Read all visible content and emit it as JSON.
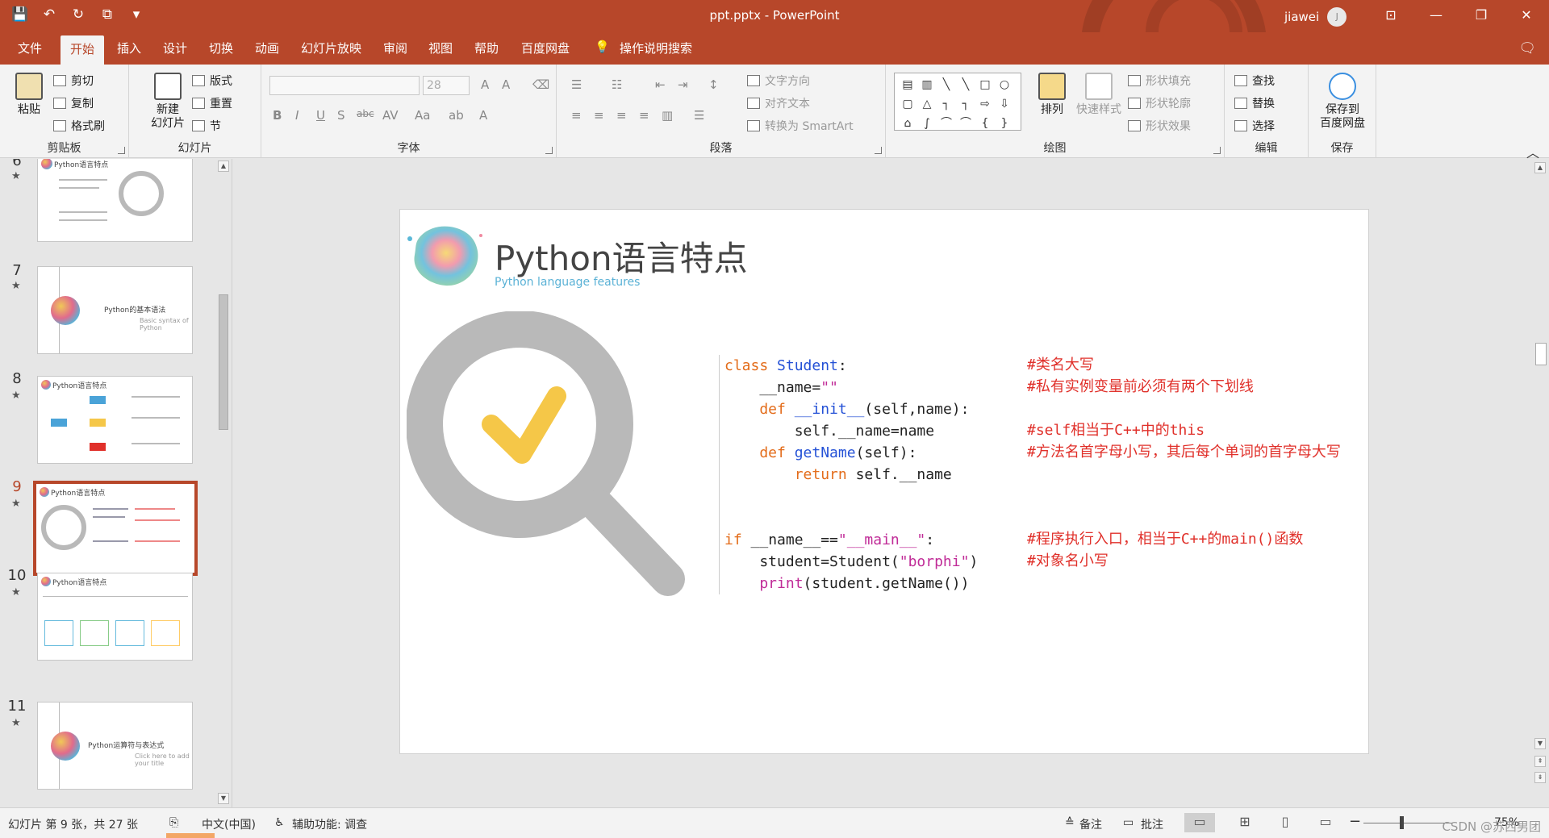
{
  "window": {
    "title": "ppt.pptx  -  PowerPoint",
    "user": "jiawei",
    "avatar_letter": "J"
  },
  "qat": {
    "save": "💾",
    "undo": "↶",
    "redo": "↻",
    "present": "⧉",
    "more": "▾"
  },
  "window_buttons": {
    "ribbon_display": "⊡",
    "minimize": "—",
    "restore": "❐",
    "close": "✕"
  },
  "menu": {
    "tabs": [
      "文件",
      "开始",
      "插入",
      "设计",
      "切换",
      "动画",
      "幻灯片放映",
      "审阅",
      "视图",
      "帮助",
      "百度网盘"
    ],
    "active_tab": "开始",
    "tell_me": "操作说明搜索"
  },
  "ribbon": {
    "clipboard": {
      "paste": "粘贴",
      "cut": "剪切",
      "copy": "复制",
      "format_painter": "格式刷",
      "label": "剪贴板"
    },
    "slides": {
      "new_slide_1": "新建",
      "new_slide_2": "幻灯片",
      "layout": "版式",
      "reset": "重置",
      "section": "节",
      "label": "幻灯片"
    },
    "font": {
      "size": "28",
      "label": "字体"
    },
    "paragraph": {
      "text_direction": "文字方向",
      "align_text": "对齐文本",
      "smartart": "转换为 SmartArt",
      "label": "段落"
    },
    "drawing": {
      "arrange": "排列",
      "quick_styles": "快速样式",
      "fill": "形状填充",
      "outline": "形状轮廓",
      "effects": "形状效果",
      "label": "绘图"
    },
    "editing": {
      "find": "查找",
      "replace": "替换",
      "select": "选择",
      "label": "编辑"
    },
    "save": {
      "save_to_1": "保存到",
      "save_to_2": "百度网盘",
      "label": "保存"
    }
  },
  "thumbnails": [
    {
      "number": "6",
      "title": "Python语言特点"
    },
    {
      "number": "7",
      "title": "Python的基本语法",
      "subtitle": "Basic syntax of Python"
    },
    {
      "number": "8",
      "title": "Python语言特点"
    },
    {
      "number": "9",
      "title": "Python语言特点",
      "selected": true
    },
    {
      "number": "10",
      "title": "Python语言特点"
    },
    {
      "number": "11",
      "title": "Python运算符与表达式",
      "subtitle": "Click here to add your title"
    }
  ],
  "slide": {
    "title": "Python语言特点",
    "subtitle": "Python language features",
    "code_lines": [
      {
        "parts": [
          {
            "t": "class ",
            "c": "kw"
          },
          {
            "t": "Student",
            "c": "fn"
          },
          {
            "t": ":",
            "c": ""
          }
        ]
      },
      {
        "parts": [
          {
            "t": "    __name=",
            "c": ""
          },
          {
            "t": "\"\"",
            "c": "str"
          }
        ]
      },
      {
        "parts": [
          {
            "t": "    def ",
            "c": "kw"
          },
          {
            "t": "__init__",
            "c": "fn"
          },
          {
            "t": "(self,name):",
            "c": ""
          }
        ]
      },
      {
        "parts": [
          {
            "t": "        self.__name=name",
            "c": ""
          }
        ]
      },
      {
        "parts": [
          {
            "t": "    def ",
            "c": "kw"
          },
          {
            "t": "getName",
            "c": "fn"
          },
          {
            "t": "(self):",
            "c": ""
          }
        ]
      },
      {
        "parts": [
          {
            "t": "        return ",
            "c": "kw"
          },
          {
            "t": "self.__name",
            "c": ""
          }
        ]
      },
      {
        "parts": [
          {
            "t": "",
            "c": ""
          }
        ]
      },
      {
        "parts": [
          {
            "t": "",
            "c": ""
          }
        ]
      },
      {
        "parts": [
          {
            "t": "if ",
            "c": "kw"
          },
          {
            "t": "__name__==",
            "c": ""
          },
          {
            "t": "\"__main__\"",
            "c": "str"
          },
          {
            "t": ":",
            "c": ""
          }
        ]
      },
      {
        "parts": [
          {
            "t": "    student=Student(",
            "c": ""
          },
          {
            "t": "\"borphi\"",
            "c": "str"
          },
          {
            "t": ")",
            "c": ""
          }
        ]
      },
      {
        "parts": [
          {
            "t": "    print",
            "c": "str"
          },
          {
            "t": "(student.getName())",
            "c": ""
          }
        ]
      }
    ],
    "comments": [
      "#类名大写",
      "#私有实例变量前必须有两个下划线",
      "#self相当于C++中的this",
      "#方法名首字母小写，其后每个单词的首字母大写",
      "#程序执行入口，相当于C++的main()函数",
      "#对象名小写"
    ]
  },
  "status": {
    "slide_info": "幻灯片 第 9 张，共 27 张",
    "language": "中文(中国)",
    "accessibility": "辅助功能: 调查",
    "notes": "备注",
    "comments": "批注",
    "zoom": "75%",
    "watermark": "CSDN @苏西男团"
  },
  "colors": {
    "accent": "#b7472a",
    "keyword": "#e36c1a",
    "function": "#2451d6",
    "string": "#c02b97",
    "comment": "#e0302a",
    "check": "#f5c748"
  }
}
